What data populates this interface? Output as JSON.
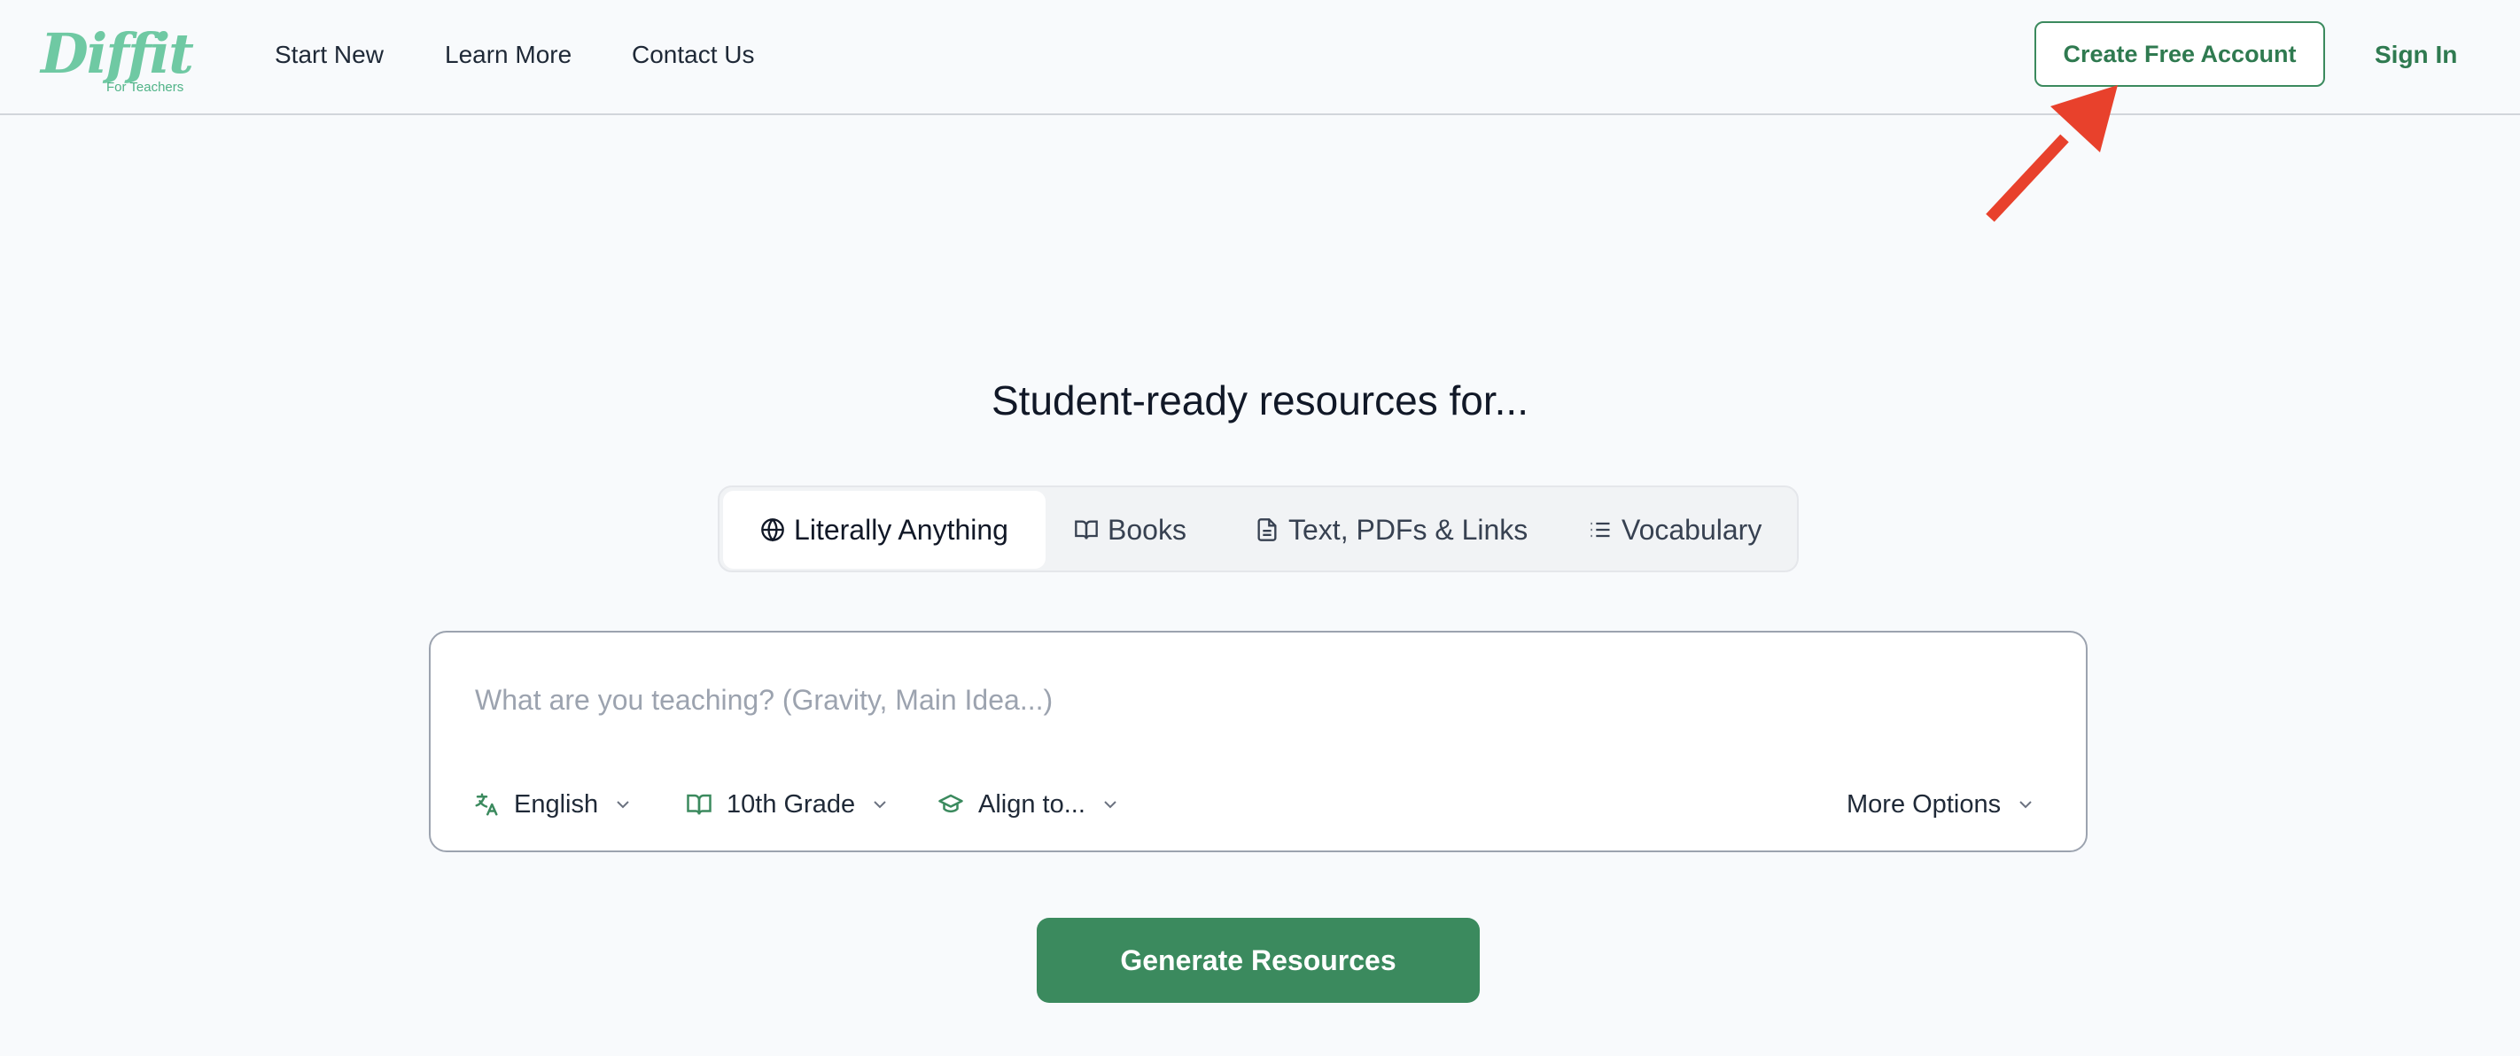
{
  "brand": {
    "logo_text": "Diffit",
    "tagline": "For Teachers"
  },
  "nav": {
    "links": [
      "Start New",
      "Learn More",
      "Contact Us"
    ],
    "create_account": "Create Free Account",
    "sign_in": "Sign In"
  },
  "main": {
    "headline": "Student-ready resources for...",
    "tabs": [
      {
        "label": "Literally Anything",
        "icon": "globe-icon",
        "active": true
      },
      {
        "label": "Books",
        "icon": "book-icon",
        "active": false
      },
      {
        "label": "Text, PDFs & Links",
        "icon": "document-icon",
        "active": false
      },
      {
        "label": "Vocabulary",
        "icon": "list-icon",
        "active": false
      }
    ],
    "prompt": {
      "value": "",
      "placeholder": "What are you teaching? (Gravity, Main Idea...)"
    },
    "options": {
      "language": "English",
      "grade": "10th Grade",
      "align": "Align to...",
      "more": "More Options"
    },
    "generate": "Generate Resources"
  },
  "colors": {
    "brand_green": "#3b8a5e",
    "logo_green": "#6fc9a3",
    "annotation_red": "#e8412c"
  },
  "annotation": {
    "icon": "red-arrow-icon"
  }
}
